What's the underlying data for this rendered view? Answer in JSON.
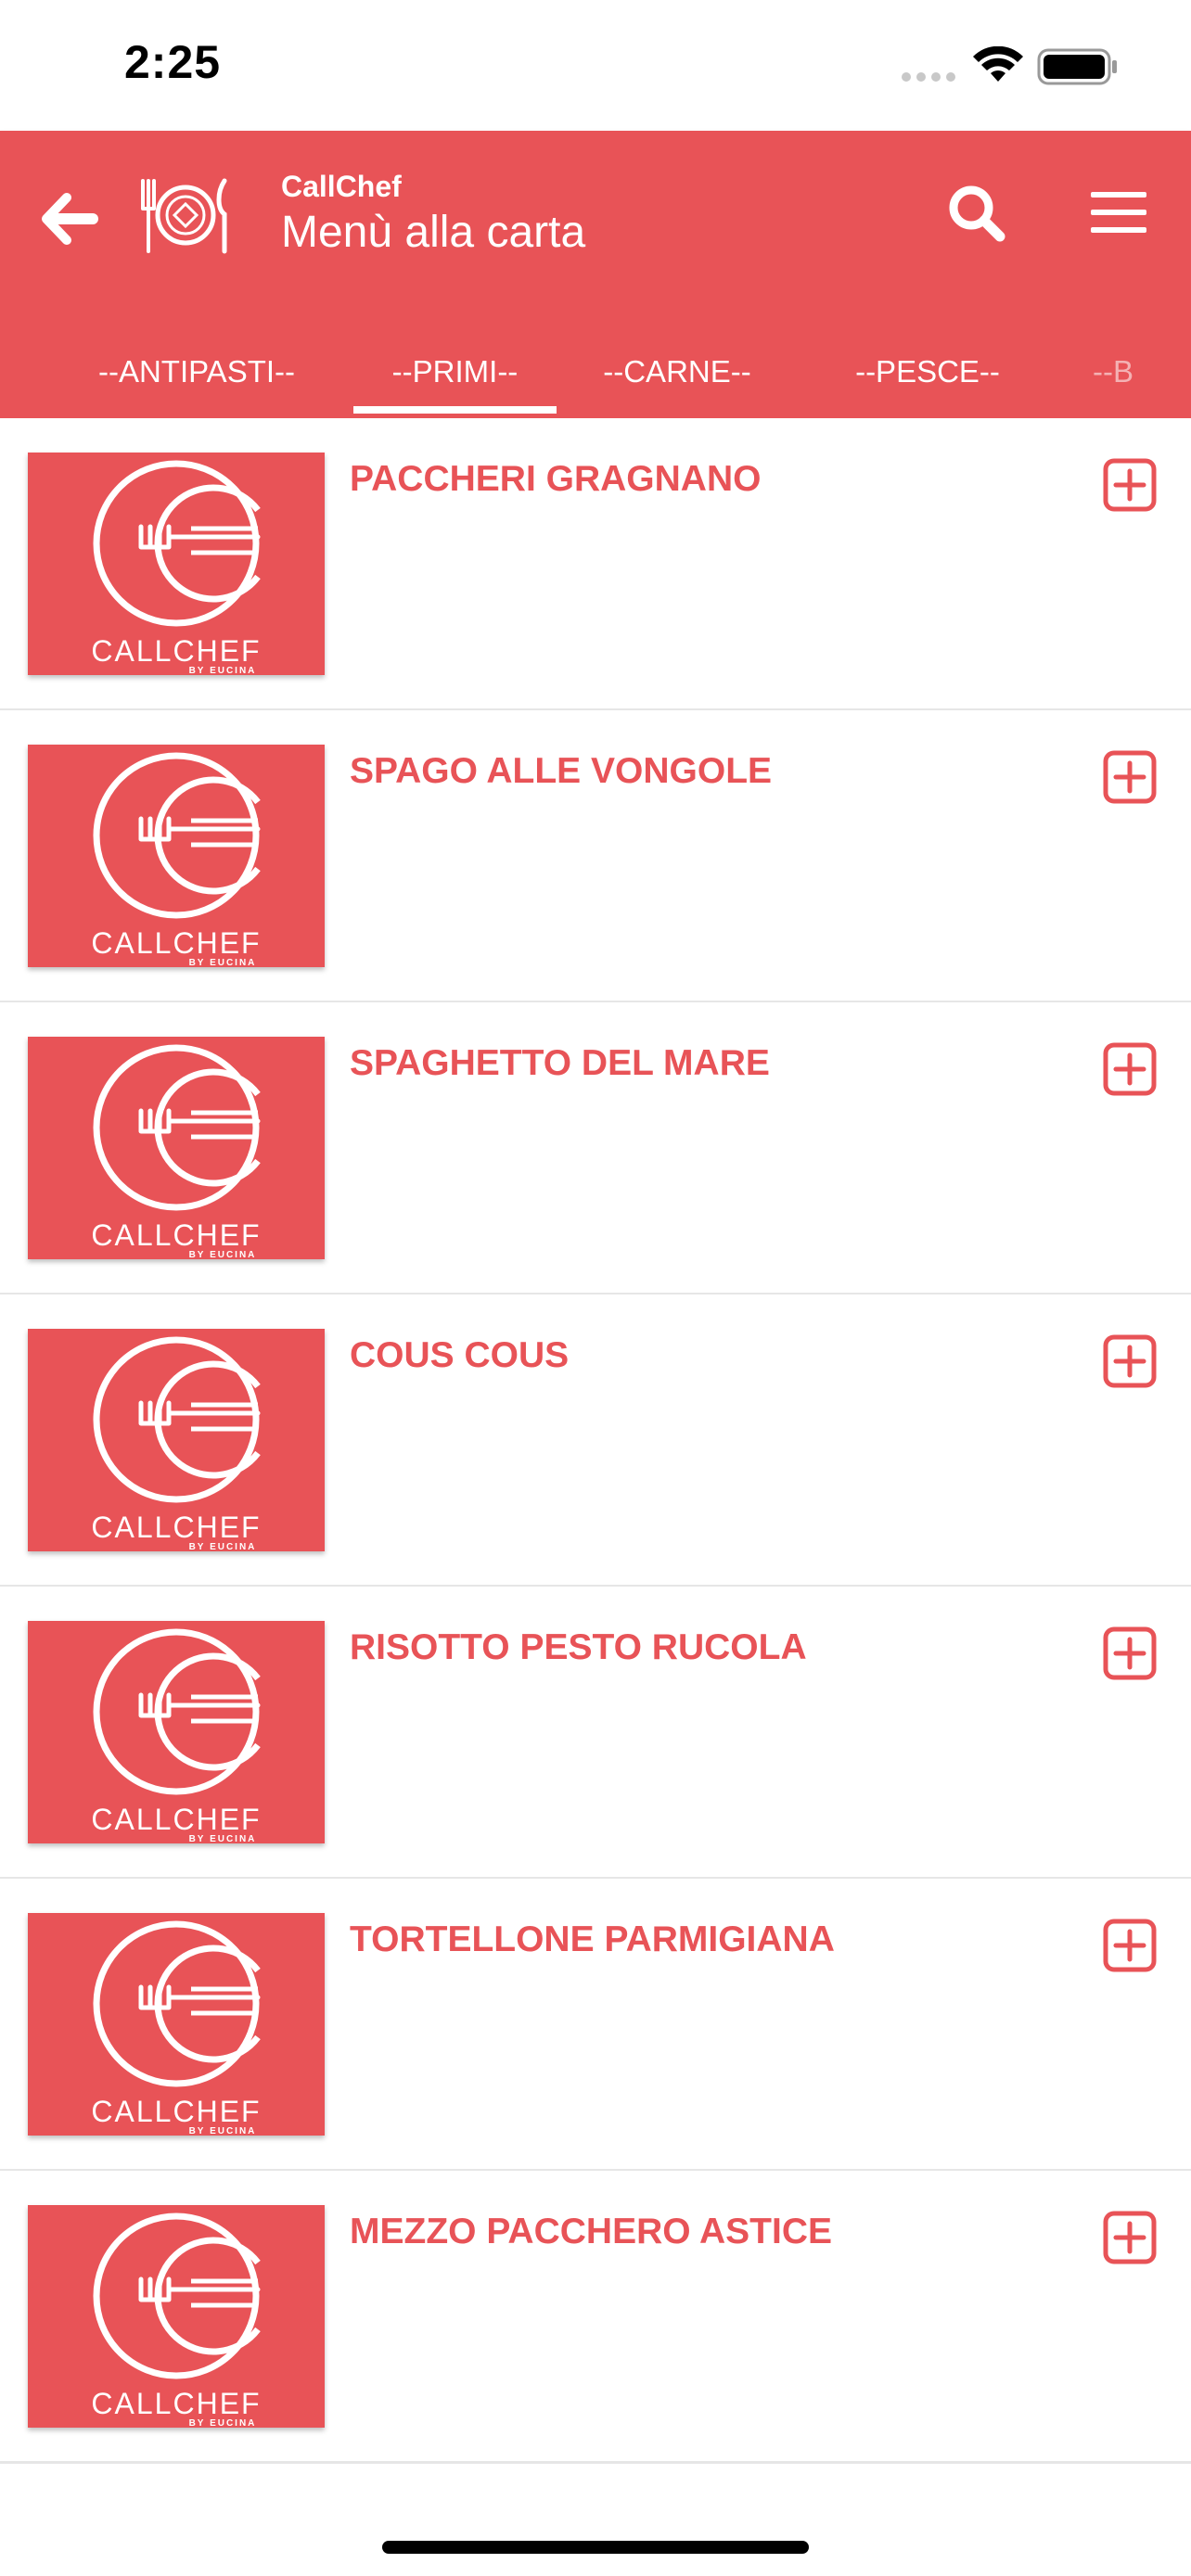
{
  "status_bar": {
    "time": "2:25"
  },
  "header": {
    "app_name": "CallChef",
    "title": "Menù alla carta",
    "bg_color": "#e85357"
  },
  "tabs": [
    {
      "label": "--ANTIPASTI--"
    },
    {
      "label": "--PRIMI--"
    },
    {
      "label": "--CARNE--"
    },
    {
      "label": "--PESCE--"
    },
    {
      "label": "--B"
    }
  ],
  "selected_tab": "--PRIMI--",
  "thumbnail": {
    "brand_text": "CALLCHEF",
    "sub_text": "BY EUCINA"
  },
  "dishes": [
    {
      "name": "PACCHERI GRAGNANO"
    },
    {
      "name": "SPAGO ALLE VONGOLE"
    },
    {
      "name": "SPAGHETTO DEL MARE"
    },
    {
      "name": "COUS COUS"
    },
    {
      "name": "RISOTTO PESTO RUCOLA"
    },
    {
      "name": "TORTELLONE PARMIGIANA"
    },
    {
      "name": "MEZZO PACCHERO ASTICE"
    }
  ],
  "icons": {
    "back": "arrow-left-icon",
    "logo": "plate-cutlery-logo-icon",
    "search": "search-icon",
    "menu": "hamburger-menu-icon",
    "add": "plus-square-icon"
  }
}
